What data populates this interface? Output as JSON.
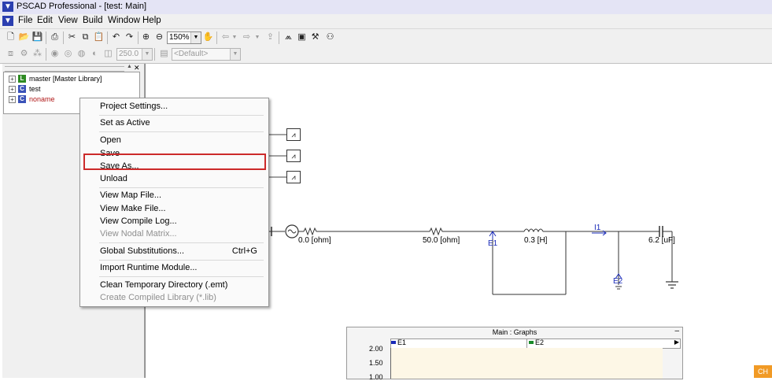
{
  "window": {
    "title": "PSCAD Professional - [test: Main]"
  },
  "menubar": {
    "items": [
      "File",
      "Edit",
      "View",
      "Build",
      "Window",
      "Help"
    ]
  },
  "toolbar": {
    "zoom": "150%",
    "runtime_value": "250.0",
    "default_combo": "<Default>"
  },
  "workspace": {
    "tree": [
      {
        "label": "master [Master Library]",
        "color": "#000000",
        "icon_color": "#2e8b22"
      },
      {
        "label": "test",
        "color": "#000000",
        "icon_color": "#3a52b8"
      },
      {
        "label": "noname",
        "color": "#b01818",
        "icon_color": "#3a52b8"
      }
    ]
  },
  "context_menu": {
    "items": [
      {
        "label": "Project Settings...",
        "enabled": true
      },
      {
        "label": "Set as Active",
        "enabled": true
      },
      {
        "label": "Open",
        "enabled": true
      },
      {
        "label": "Save",
        "enabled": true
      },
      {
        "label": "Save As...",
        "enabled": true,
        "highlighted": true
      },
      {
        "label": "Unload",
        "enabled": true
      },
      {
        "label": "View Map File...",
        "enabled": true
      },
      {
        "label": "View Make File...",
        "enabled": true
      },
      {
        "label": "View Compile Log...",
        "enabled": true
      },
      {
        "label": "View Nodal Matrix...",
        "enabled": false
      },
      {
        "label": "Global Substitutions...",
        "enabled": true,
        "shortcut": "Ctrl+G"
      },
      {
        "label": "Import Runtime Module...",
        "enabled": true
      },
      {
        "label": "Clean Temporary Directory (.emt)",
        "enabled": true
      },
      {
        "label": "Create Compiled Library (*.lib)",
        "enabled": false
      }
    ]
  },
  "circuit": {
    "labels": {
      "r1": "0.0 [ohm]",
      "r2": "50.0 [ohm]",
      "l1": "0.3 [H]",
      "c1": "6.2 [uF]",
      "e1": "E1",
      "e2": "E2",
      "i1": "I1"
    }
  },
  "graphs": {
    "title": "Main : Graphs",
    "legend": [
      "E1",
      "E2"
    ],
    "series_colors": [
      "#1a2bb8",
      "#1a8a2a"
    ],
    "y_ticks": [
      "2.00",
      "1.50",
      "1.00"
    ]
  },
  "taskbar": {
    "language_indicator": "CH"
  }
}
